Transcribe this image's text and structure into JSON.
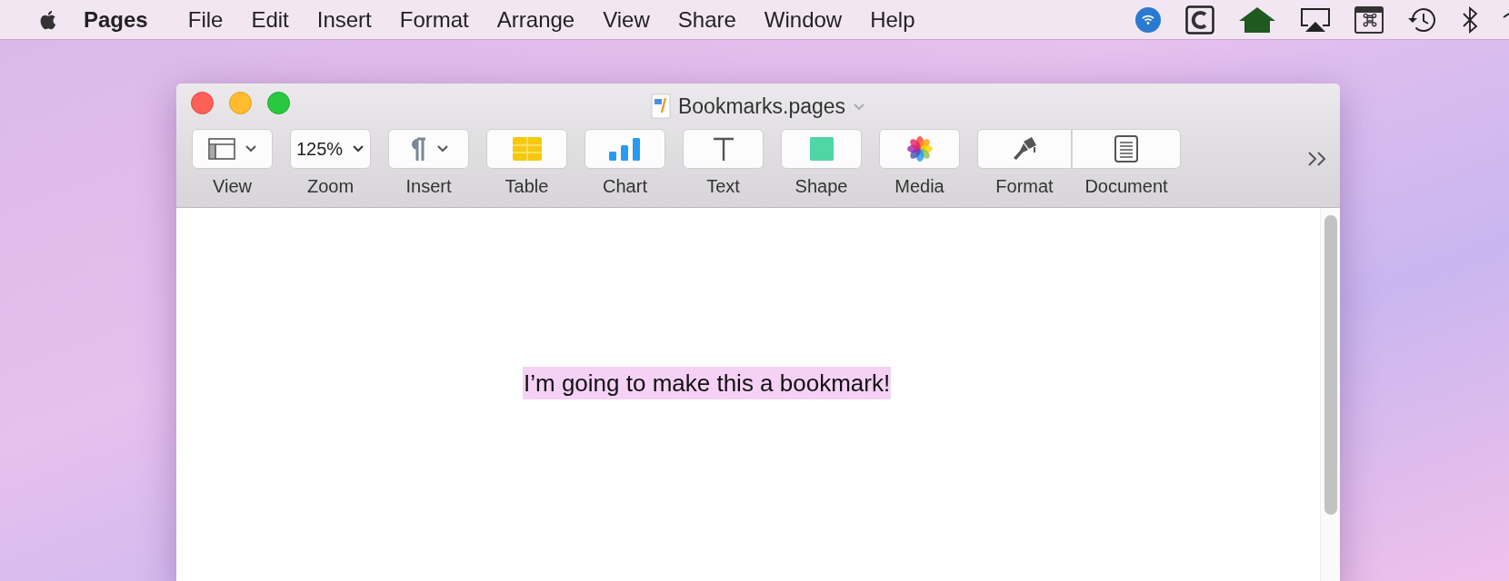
{
  "menu_bar": {
    "items": [
      {
        "label": "Pages",
        "kind": "app"
      },
      {
        "label": "File",
        "kind": "menu"
      },
      {
        "label": "Edit",
        "kind": "menu"
      },
      {
        "label": "Insert",
        "kind": "menu"
      },
      {
        "label": "Format",
        "kind": "menu"
      },
      {
        "label": "Arrange",
        "kind": "menu"
      },
      {
        "label": "View",
        "kind": "menu"
      },
      {
        "label": "Share",
        "kind": "menu"
      },
      {
        "label": "Window",
        "kind": "menu"
      },
      {
        "label": "Help",
        "kind": "menu"
      }
    ]
  },
  "window": {
    "title": "Bookmarks.pages",
    "toolbar": [
      {
        "label": "View",
        "kind": "view"
      },
      {
        "label": "Zoom",
        "kind": "zoom",
        "value": "125%"
      },
      {
        "label": "Insert",
        "kind": "insert"
      },
      {
        "label": "Table",
        "kind": "table"
      },
      {
        "label": "Chart",
        "kind": "chart"
      },
      {
        "label": "Text",
        "kind": "text"
      },
      {
        "label": "Shape",
        "kind": "shape"
      },
      {
        "label": "Media",
        "kind": "media"
      },
      {
        "label": "Format",
        "kind": "format",
        "joined_to_next": true
      },
      {
        "label": "Document",
        "kind": "document",
        "joined_to_previous": true
      }
    ],
    "document": {
      "text": "I’m going to make this a bookmark!",
      "highlighted": true
    }
  }
}
